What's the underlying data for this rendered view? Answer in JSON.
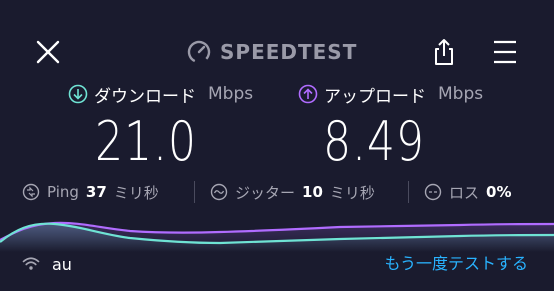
{
  "header": {
    "brand": "SPEEDTEST"
  },
  "download": {
    "label": "ダウンロード",
    "unit": "Mbps",
    "value": "21.0",
    "color": "#6fe3d4"
  },
  "upload": {
    "label": "アップロード",
    "unit": "Mbps",
    "value": "8.49",
    "color": "#b06cff"
  },
  "stats": {
    "ping": {
      "label": "Ping",
      "value": "37",
      "unit": "ミリ秒"
    },
    "jitter": {
      "label": "ジッター",
      "value": "10",
      "unit": "ミリ秒"
    },
    "loss": {
      "label": "ロス",
      "value": "0%"
    }
  },
  "footer": {
    "carrier": "au",
    "retry_label": "もう一度テストする"
  },
  "colors": {
    "background": "#1a1b2e",
    "accent_link": "#29b3ff",
    "download": "#6fe3d4",
    "upload": "#b06cff"
  }
}
